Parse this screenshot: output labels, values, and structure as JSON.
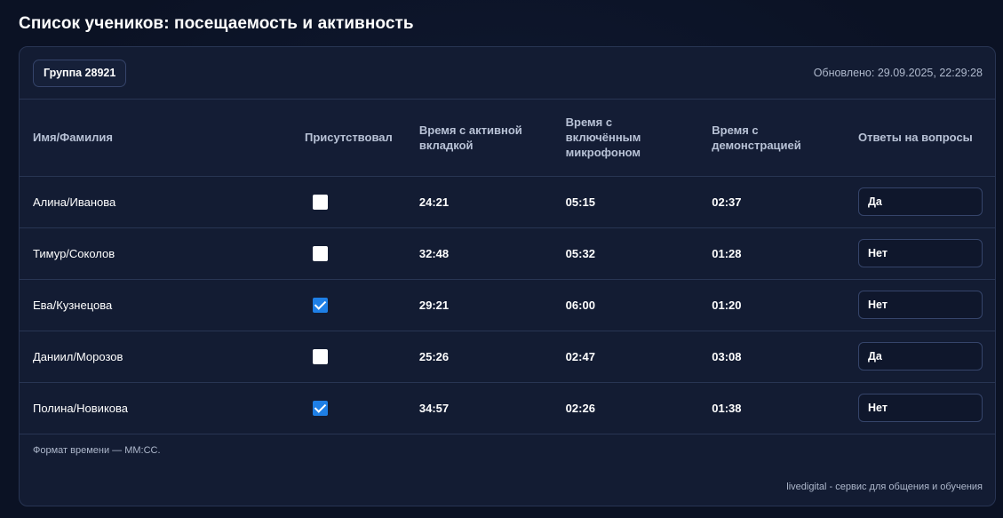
{
  "page": {
    "title": "Список учеников: посещаемость и активность"
  },
  "header": {
    "group_label": "Группа 28921",
    "updated": "Обновлено: 29.09.2025, 22:29:28"
  },
  "table": {
    "columns": [
      "Имя/Фамилия",
      "Присутствовал",
      "Время с активной вкладкой",
      "Время с включённым микрофоном",
      "Время с демонстрацией",
      "Ответы на вопросы"
    ],
    "rows": [
      {
        "name": "Алина/Иванова",
        "present": false,
        "active_tab": "24:21",
        "mic": "05:15",
        "demo": "02:37",
        "answers": "Да"
      },
      {
        "name": "Тимур/Соколов",
        "present": false,
        "active_tab": "32:48",
        "mic": "05:32",
        "demo": "01:28",
        "answers": "Нет"
      },
      {
        "name": "Ева/Кузнецова",
        "present": true,
        "active_tab": "29:21",
        "mic": "06:00",
        "demo": "01:20",
        "answers": "Нет"
      },
      {
        "name": "Даниил/Морозов",
        "present": false,
        "active_tab": "25:26",
        "mic": "02:47",
        "demo": "03:08",
        "answers": "Да"
      },
      {
        "name": "Полина/Новикова",
        "present": true,
        "active_tab": "34:57",
        "mic": "02:26",
        "demo": "01:38",
        "answers": "Нет"
      }
    ]
  },
  "footer": {
    "note": "Формат времени — ММ:СС.",
    "brand": "livedigital - сервис для общения и обучения"
  },
  "colors": {
    "background": "#0b1224",
    "card": "#131c33",
    "checkbox_checked": "#1e7fe6",
    "border": "#283553"
  }
}
